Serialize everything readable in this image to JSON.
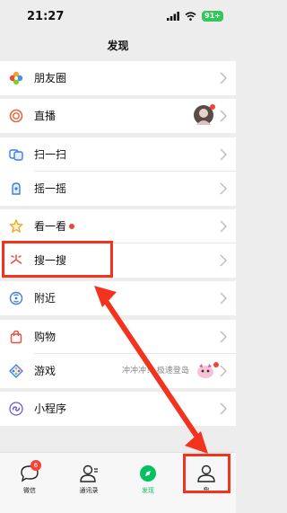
{
  "status_bar": {
    "time": "21:27",
    "battery": "91+"
  },
  "header": {
    "title": "发现"
  },
  "rows": {
    "moments": "朋友圈",
    "live": "直播",
    "scan": "扫一扫",
    "shake": "摇一摇",
    "top_stories": "看一看",
    "search": "搜一搜",
    "nearby": "附近",
    "shopping": "购物",
    "games": "游戏",
    "games_promo": "冲冲冲！ 极速登岛",
    "mini_programs": "小程序"
  },
  "tabs": {
    "chats": "微信",
    "chats_badge": "6",
    "contacts": "通讯录",
    "discover": "发现",
    "me": "我"
  },
  "colors": {
    "accent_green": "#07c160",
    "annotation_red": "#f4331f",
    "badge_red": "#f44336"
  }
}
